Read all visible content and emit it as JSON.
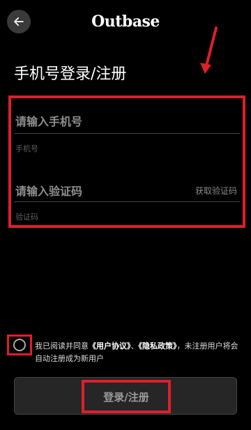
{
  "header": {
    "back_icon": "arrow-left-icon",
    "logo_text": "Outbase"
  },
  "page": {
    "title": "手机号登录/注册"
  },
  "form": {
    "phone": {
      "label": "请输入手机号",
      "hint": "手机号"
    },
    "code": {
      "label": "请输入验证码",
      "hint": "验证码",
      "get_code_label": "获取验证码"
    }
  },
  "agreement": {
    "prefix": "我已阅读并同意",
    "user_agreement": "《用户协议》",
    "separator": "、",
    "privacy_policy": "《隐私政策》",
    "suffix": "，未注册用户将会自动注册成为新用户"
  },
  "submit": {
    "label": "登录/注册"
  },
  "colors": {
    "annotation": "#e01e2b",
    "background": "#000000"
  }
}
